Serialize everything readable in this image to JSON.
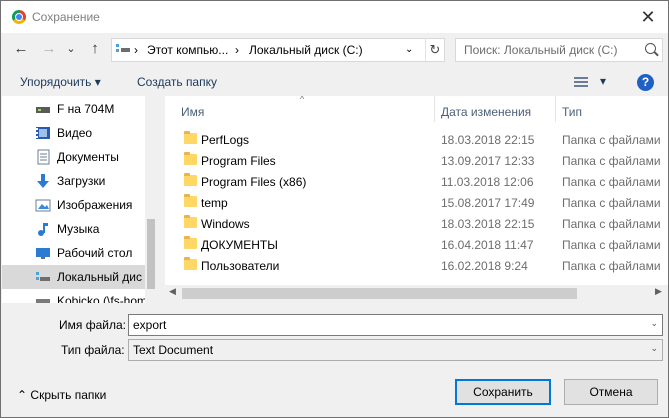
{
  "window": {
    "title": "Сохранение",
    "close_glyph": "✕"
  },
  "nav": {
    "back_glyph": "←",
    "forward_glyph": "→",
    "recent_glyph": "⌄",
    "up_glyph": "↑",
    "breadcrumbs": [
      "Этот компью...",
      "Локальный диск (C:)"
    ],
    "crumb_sep": "›",
    "refresh_glyph": "↻",
    "search_placeholder": "Поиск: Локальный диск (C:)"
  },
  "toolbar": {
    "organize": "Упорядочить",
    "new_folder": "Создать папку",
    "dropdown": "▾",
    "help": "?"
  },
  "sidebar": {
    "items": [
      {
        "label": "F на 704M",
        "icon": "drive-icon"
      },
      {
        "label": "Видео",
        "icon": "video-icon"
      },
      {
        "label": "Документы",
        "icon": "documents-icon"
      },
      {
        "label": "Загрузки",
        "icon": "downloads-icon"
      },
      {
        "label": "Изображения",
        "icon": "pictures-icon"
      },
      {
        "label": "Музыка",
        "icon": "music-icon"
      },
      {
        "label": "Рабочий стол",
        "icon": "desktop-icon"
      },
      {
        "label": "Локальный дис",
        "icon": "local-disk-icon",
        "selected": true
      },
      {
        "label": "Kobicko (\\fs-hom",
        "icon": "network-drive-icon"
      }
    ]
  },
  "filelist": {
    "columns": {
      "name": "Имя",
      "date": "Дата изменения",
      "type": "Тип"
    },
    "sort_glyph": "^",
    "rows": [
      {
        "name": "PerfLogs",
        "date": "18.03.2018 22:15",
        "type": "Папка с файлами"
      },
      {
        "name": "Program Files",
        "date": "13.09.2017 12:33",
        "type": "Папка с файлами"
      },
      {
        "name": "Program Files (x86)",
        "date": "11.03.2018 12:06",
        "type": "Папка с файлами"
      },
      {
        "name": "temp",
        "date": "15.08.2017 17:49",
        "type": "Папка с файлами"
      },
      {
        "name": "Windows",
        "date": "18.03.2018 22:15",
        "type": "Папка с файлами"
      },
      {
        "name": "ДОКУМЕНТЫ",
        "date": "16.04.2018 11:47",
        "type": "Папка с файлами"
      },
      {
        "name": "Пользователи",
        "date": "16.02.2018 9:24",
        "type": "Папка с файлами"
      }
    ],
    "scroll_left": "◀",
    "scroll_right": "▶"
  },
  "form": {
    "filename_label": "Имя файла:",
    "filename_value": "export",
    "filetype_label": "Тип файла:",
    "filetype_value": "Text Document",
    "dropdown_glyph": "⌄"
  },
  "footer": {
    "hide_folders": "Скрыть папки",
    "hide_glyph": "⌃",
    "save": "Сохранить",
    "cancel": "Отмена"
  },
  "colors": {
    "accent": "#0078d7",
    "folder": "#ffd764",
    "selected": "#d9d9d9"
  }
}
